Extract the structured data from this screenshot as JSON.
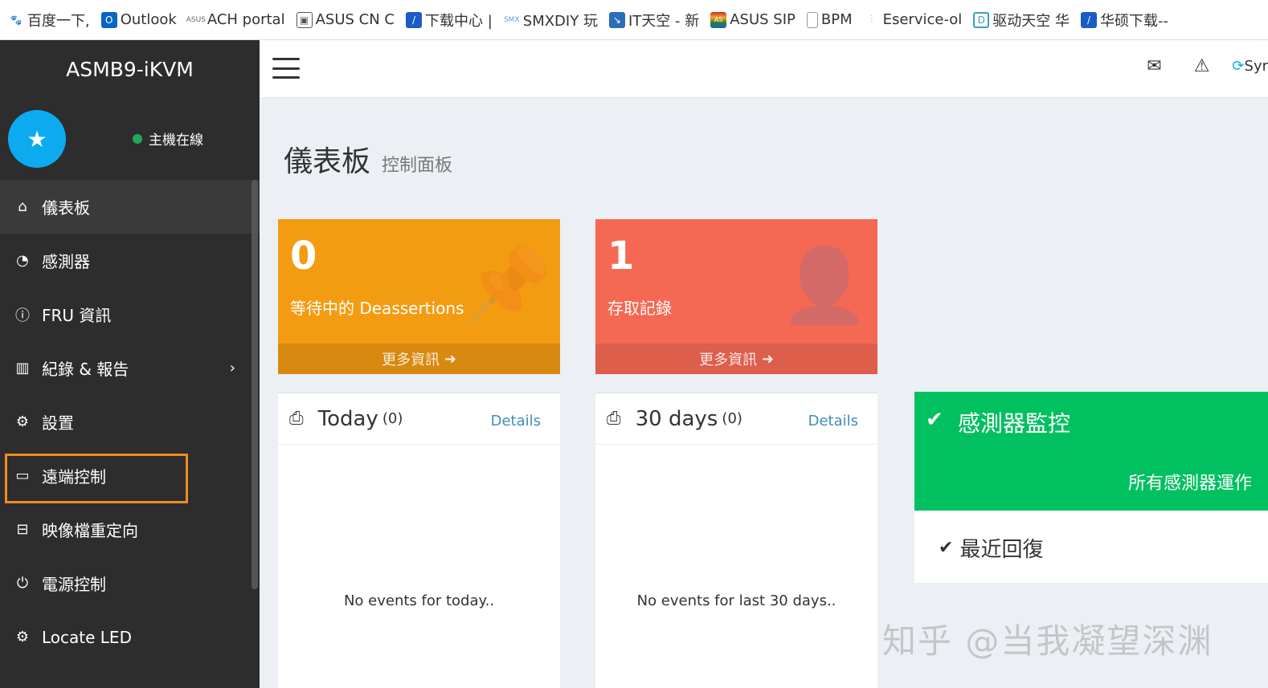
{
  "bookmarks": [
    {
      "label": "百度一下,",
      "icon": "paw-icon",
      "color": "#2f6bd8"
    },
    {
      "label": "Outlook",
      "icon": "outlook-icon",
      "color": "#0a64c8"
    },
    {
      "label": "ACH portal",
      "icon": "asus-emea-icon",
      "color": "#666666"
    },
    {
      "label": "ASUS CN C",
      "icon": "image-icon",
      "color": "#555555"
    },
    {
      "label": "下载中心 |",
      "icon": "asus-blue-icon",
      "color": "#1a5bc6"
    },
    {
      "label": "SMXDIY 玩",
      "icon": "smx-icon",
      "color": "#5aa0e0"
    },
    {
      "label": "IT天空 - 新",
      "icon": "it-sky-icon",
      "color": "#2a6db8"
    },
    {
      "label": "ASUS SIP",
      "icon": "asus-flag-icon",
      "color": "#c62828"
    },
    {
      "label": "BPM",
      "icon": "document-icon",
      "color": "#999999"
    },
    {
      "label": "Eservice-ol",
      "icon": "plug-icon",
      "color": "#c99"
    },
    {
      "label": "驱动天空 华",
      "icon": "drive-sky-icon",
      "color": "#3aa0c0"
    },
    {
      "label": "华硕下载--",
      "icon": "asus-blue-icon",
      "color": "#1a5bc6"
    }
  ],
  "brand": {
    "title": "ASMB9-iKVM"
  },
  "user": {
    "status": "主機在線"
  },
  "menu": [
    {
      "label": "儀表板",
      "icon": "home-icon"
    },
    {
      "label": "感測器",
      "icon": "dashboard-gauge-icon"
    },
    {
      "label": "FRU 資訊",
      "icon": "info-icon"
    },
    {
      "label": "紀錄 & 報告",
      "icon": "bar-chart-icon",
      "arrow": "›"
    },
    {
      "label": "設置",
      "icon": "gear-icon"
    },
    {
      "label": "遠端控制",
      "icon": "monitor-icon"
    },
    {
      "label": "映像檔重定向",
      "icon": "hard-drive-icon"
    },
    {
      "label": "電源控制",
      "icon": "power-icon"
    },
    {
      "label": "Locate LED",
      "icon": "gear-icon"
    }
  ],
  "topbar": {
    "sync_label": "Syr"
  },
  "page": {
    "title": "儀表板",
    "subtitle": "控制面板"
  },
  "boxes": {
    "pending": {
      "value": "0",
      "label": "等待中的 Deassertions",
      "more": "更多資訊",
      "color": "#f39c12"
    },
    "access": {
      "value": "1",
      "label": "存取記錄",
      "more": "更多資訊",
      "color": "#f56954"
    }
  },
  "panels": {
    "today": {
      "title": "Today",
      "count": "(0)",
      "details": "Details",
      "empty": "No events for today.."
    },
    "days30": {
      "title": "30 days",
      "count": "(0)",
      "details": "Details",
      "empty": "No events for last 30 days.."
    }
  },
  "sensor": {
    "title": "感測器監控",
    "message": "所有感測器運作",
    "recent": "最近回復",
    "color": "#00c060"
  },
  "watermark": "知乎 @当我凝望深渊"
}
